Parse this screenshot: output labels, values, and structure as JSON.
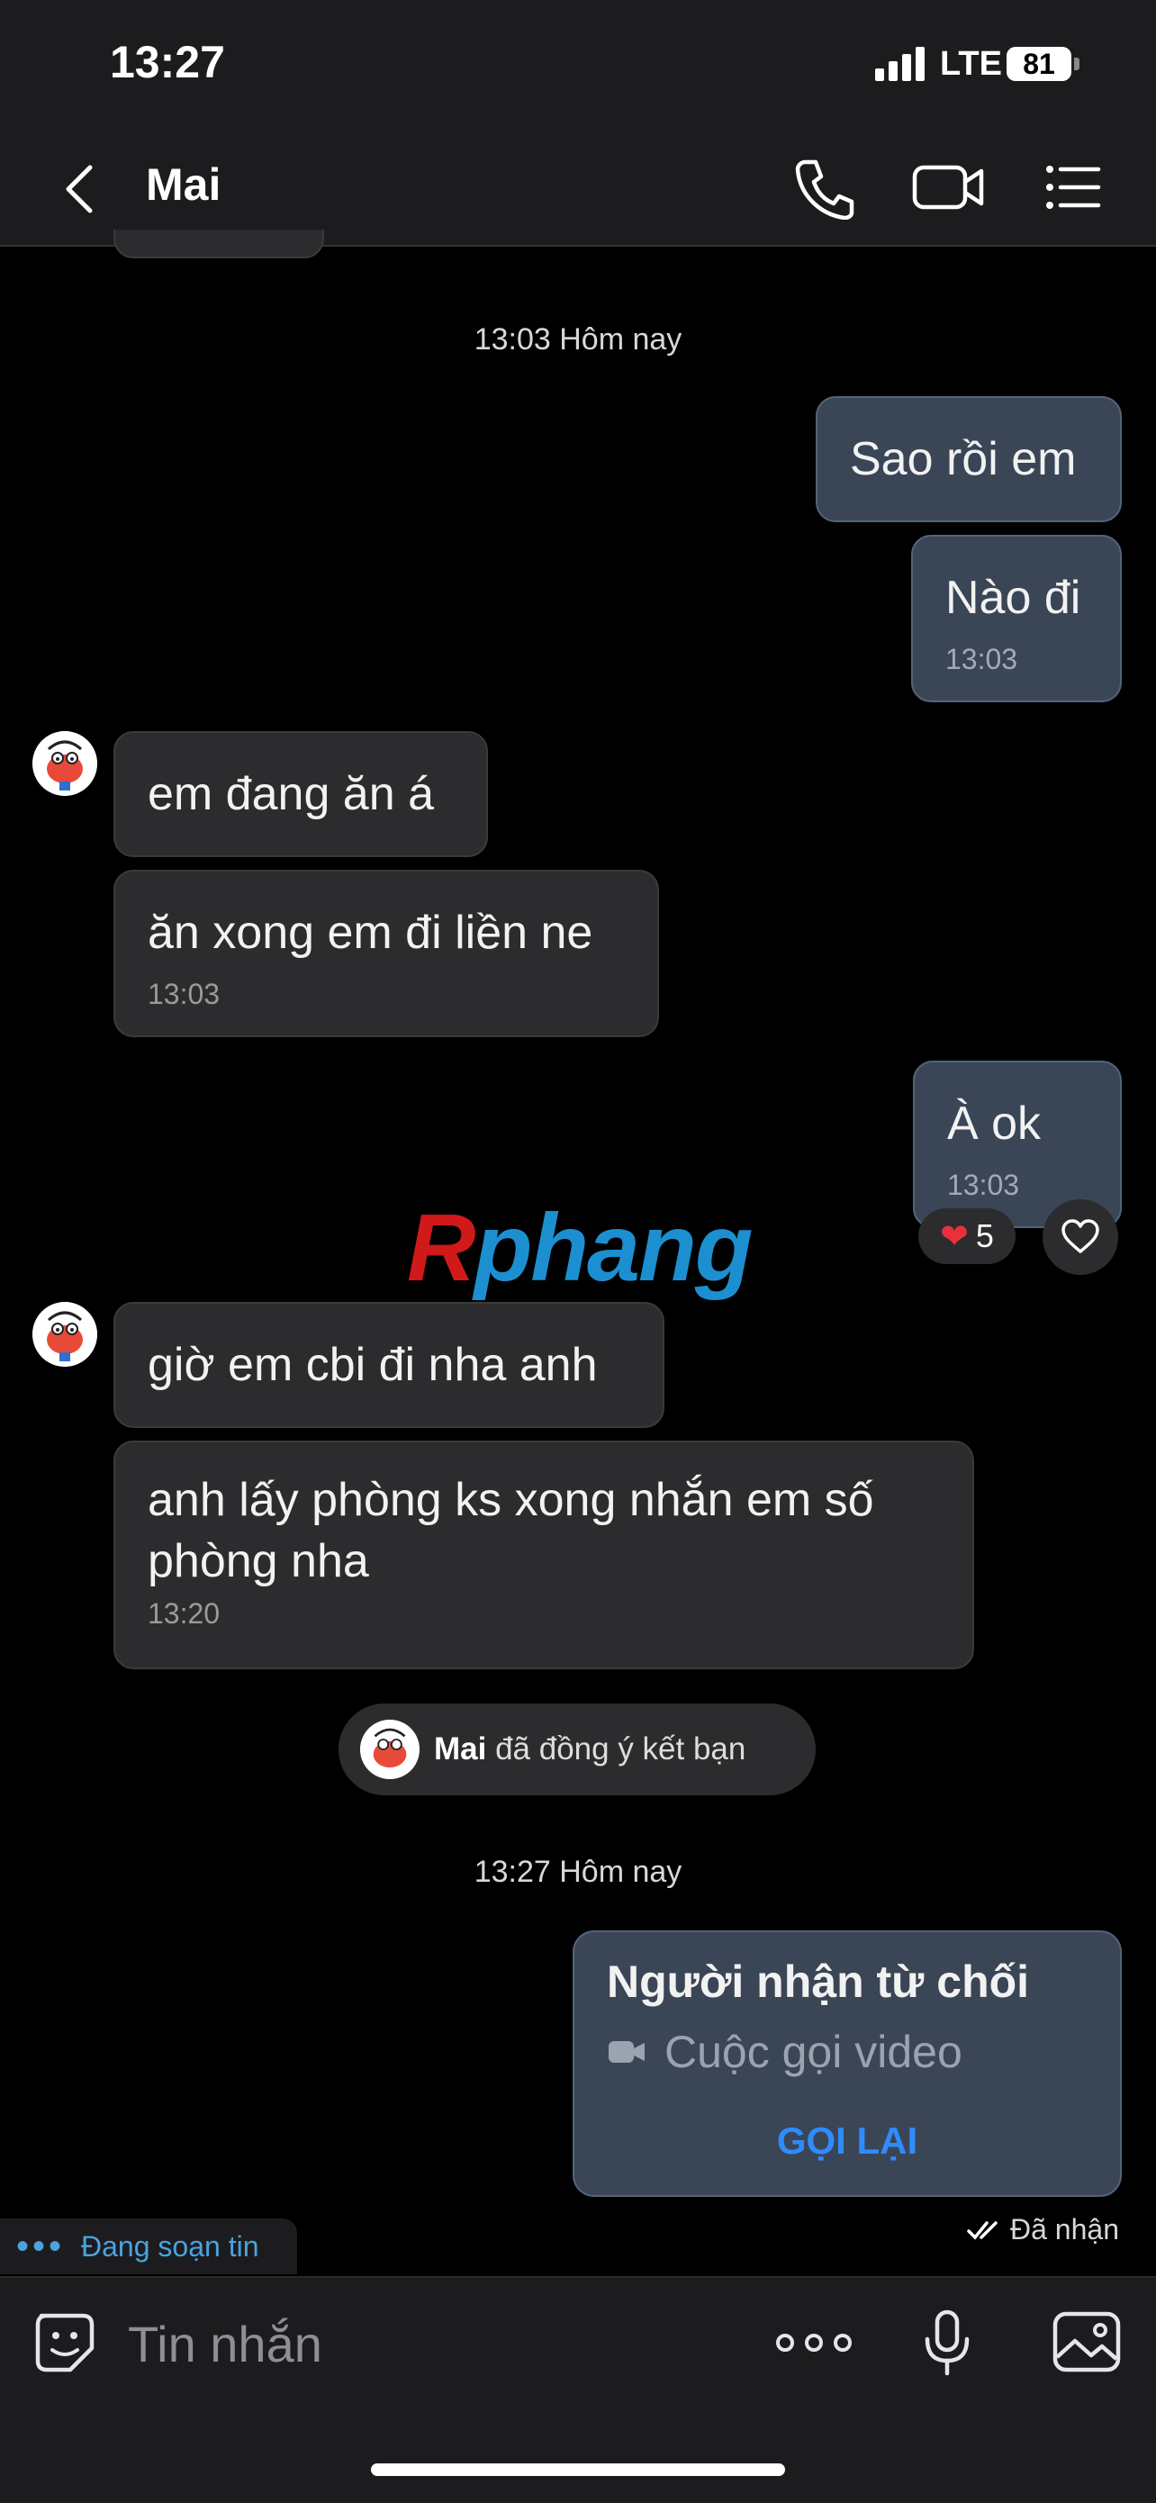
{
  "status_bar": {
    "time": "13:27",
    "network": "LTE",
    "battery": "81"
  },
  "header": {
    "contact_name": "Mai"
  },
  "messages": {
    "sep1": "13:03 Hôm nay",
    "m1": "Sao rồi em",
    "m2": "Nào đi",
    "m2_time": "13:03",
    "m3": "em đang ăn á",
    "m4": "ăn xong em đi liền ne",
    "m4_time": "13:03",
    "m5": "À ok",
    "m5_time": "13:03",
    "reaction_count": "5",
    "m6": "giờ em cbi đi nha anh",
    "m7": "anh lấy phòng ks xong nhắn em số phòng nha",
    "m7_time": "13:20",
    "sep2": "13:27 Hôm nay"
  },
  "watermark": {
    "part1": "R",
    "part2": "phang"
  },
  "friend_notice": {
    "name": "Mai",
    "text": "đã đồng ý kết bạn"
  },
  "missed_call": {
    "title": "Người nhận từ chối",
    "subtitle": "Cuộc gọi video",
    "action": "GỌI LẠI"
  },
  "delivery_status": "Đã nhận",
  "typing": {
    "dots": "•••",
    "text": "Đang soạn tin"
  },
  "composer": {
    "placeholder": "Tin nhắn"
  },
  "colors": {
    "outgoing_bubble": "#3a4656",
    "incoming_bubble": "#2c2c2e",
    "accent": "#2f8cff",
    "typing": "#4aa3df"
  }
}
